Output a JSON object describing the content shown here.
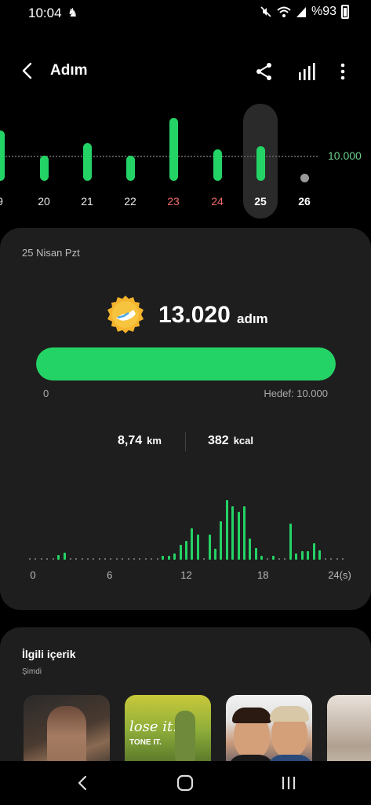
{
  "status": {
    "time": "10:04",
    "battery": "%93"
  },
  "header": {
    "title": "Adım",
    "back_icon": "chevron-left-icon",
    "share_icon": "share-icon",
    "stats_icon": "bar-chart-icon",
    "more_icon": "more-vertical-icon"
  },
  "days": {
    "goal_label": "10.000",
    "selected": "25",
    "items": [
      {
        "label": "9",
        "steps_rel": 0.8,
        "style": "normal"
      },
      {
        "label": "20",
        "steps_rel": 0.4,
        "style": "normal"
      },
      {
        "label": "21",
        "steps_rel": 0.6,
        "style": "normal"
      },
      {
        "label": "22",
        "steps_rel": 0.4,
        "style": "normal"
      },
      {
        "label": "23",
        "steps_rel": 1.0,
        "style": "red"
      },
      {
        "label": "24",
        "steps_rel": 0.5,
        "style": "red"
      },
      {
        "label": "25",
        "steps_rel": 0.55,
        "style": "selected"
      },
      {
        "label": "26",
        "steps_rel": 0,
        "style": "bold"
      }
    ]
  },
  "summary": {
    "date": "25 Nisan Pzt",
    "steps": "13.020",
    "steps_unit": "adım",
    "progress": 1.0,
    "progress_min": "0",
    "goal": "Hedef: 10.000",
    "distance_value": "8,74",
    "distance_unit": "km",
    "calories_value": "382",
    "calories_unit": "kcal",
    "accent": "#24d366"
  },
  "chart_data": {
    "type": "bar",
    "title": "",
    "xlabel": "",
    "ylabel": "",
    "x_ticks": [
      "0",
      "6",
      "12",
      "18",
      "24(s)"
    ],
    "xlim": [
      0,
      24
    ],
    "series": [
      {
        "values": [
          0,
          0,
          0,
          0,
          0,
          0.08,
          0.12,
          0,
          0,
          0,
          0,
          0,
          0,
          0,
          0,
          0,
          0,
          0,
          0,
          0,
          0,
          0,
          0,
          0.06,
          0.06,
          0.1,
          0.25,
          0.32,
          0.52,
          0.42,
          0,
          0.42,
          0.18,
          0.65,
          1.0,
          0.9,
          0.8,
          0.9,
          0.35,
          0.2,
          0.06,
          0,
          0.06,
          0,
          0,
          0.6,
          0.1,
          0.14,
          0.14,
          0.28,
          0.16,
          0,
          0,
          0,
          0
        ]
      }
    ]
  },
  "related": {
    "title": "İlgili içerik",
    "subtitle": "Şimdi",
    "thumb2_text1": "lose it.",
    "thumb2_text2": "TONE IT."
  }
}
